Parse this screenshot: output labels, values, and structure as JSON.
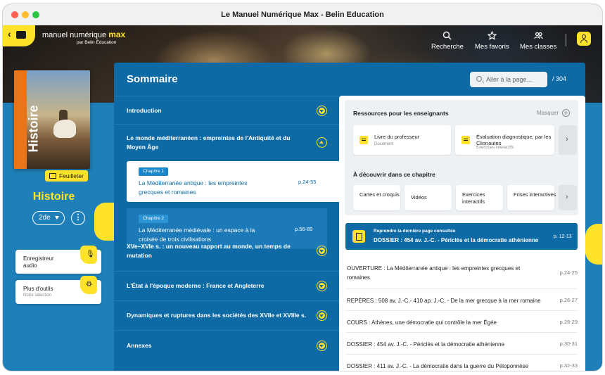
{
  "window": {
    "title": "Le Manuel Numérique Max - Belin Education"
  },
  "logo": {
    "main": "manuel numérique",
    "accent": "max",
    "sub": "par Belin Éducation"
  },
  "nav": [
    {
      "label": "Recherche",
      "icon": "search-icon"
    },
    {
      "label": "Mes favoris",
      "icon": "star-icon"
    },
    {
      "label": "Mes classes",
      "icon": "users-icon"
    }
  ],
  "book": {
    "cover_title": "Histoire",
    "flip_label": "Feuilleter",
    "subject": "Histoire",
    "level": "2de"
  },
  "tools": [
    {
      "label": "Enregistreur audio",
      "sub": "",
      "icon": "microphone-icon"
    },
    {
      "label": "Plus d'outils",
      "sub": "Notre sélection",
      "icon": "tools-icon"
    }
  ],
  "sommaire": {
    "title": "Sommaire",
    "search_placeholder": "Aller à la page...",
    "page_total": "/ 304",
    "sections": [
      {
        "label": "Introduction",
        "state": "collapsed"
      },
      {
        "label": "Le monde méditerranéen : empreintes de l'Antiquité et du Moyen Âge",
        "state": "expanded"
      },
      {
        "label": "XVe–XVIe s. : un nouveau rapport au monde, un temps de mutation",
        "state": "collapsed"
      },
      {
        "label": "L'État à l'époque moderne : France et Angleterre",
        "state": "collapsed"
      },
      {
        "label": "Dynamiques et ruptures dans les sociétés des XVIIe et XVIIIe s.",
        "state": "collapsed"
      },
      {
        "label": "Annexes",
        "state": "collapsed"
      }
    ],
    "chapters": [
      {
        "chip": "Chapitre 1",
        "title": "La Méditerranée antique : les empreintes grecques et romaines",
        "pages": "p.24-55"
      },
      {
        "chip": "Chapitre 2",
        "title": "La Méditerranée médiévale : un espace à la croisée de trois civilisations",
        "pages": "p.56-89"
      }
    ]
  },
  "resources": {
    "title": "Ressources pour les enseignants",
    "hide_label": "Masquer",
    "items": [
      {
        "name": "Livre du professeur",
        "sub": "Document"
      },
      {
        "name": "Évaluation diagnostique, par les Clionautes",
        "sub": "Exercices interactifs"
      }
    ],
    "discover_title": "À découvrir dans ce chapitre",
    "discover": [
      "Cartes et croquis",
      "Vidéos",
      "Exercices interactifs",
      "Frises interactives"
    ]
  },
  "resume": {
    "label": "Reprendre la dernière page consultée",
    "title": "DOSSIER : 454 av. J.-C. - Périclès et la démocratie athénienne",
    "pages": "p. 12-13"
  },
  "pages_list": [
    {
      "text": "OUVERTURE : La Méditerranée antique : les empreintes grecques et romaines",
      "pages": "p.24-25"
    },
    {
      "text": "REPÈRES : 508 av. J.-C.- 410 ap. J.-C. - De la mer grecque à la mer romaine",
      "pages": "p.26-27"
    },
    {
      "text": "COURS : Athènes, une démocratie qui contrôle la mer Égée",
      "pages": "p.28-29"
    },
    {
      "text": "DOSSIER : 454 av. J.-C. - Périclès et la démocratie athénienne",
      "pages": "p.30-31"
    },
    {
      "text": "DOSSIER : 411 av. J.-C. - La démocratie dans la guerre du Péloponnèse",
      "pages": "p.32-33"
    }
  ],
  "colors": {
    "primary": "#0e6aa5",
    "accent": "#ffe32b",
    "background": "#1f7fb9"
  }
}
